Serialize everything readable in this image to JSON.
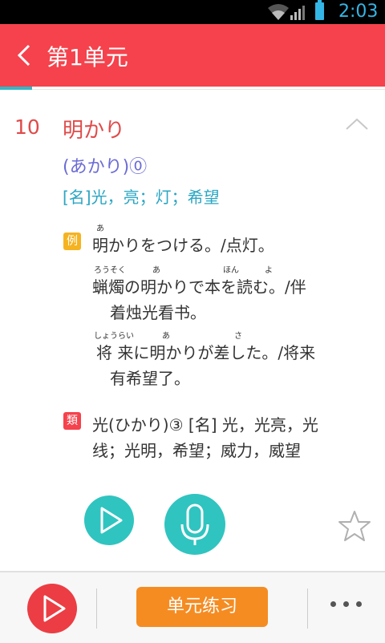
{
  "status_bar": {
    "time": "2:03"
  },
  "header": {
    "title": "第1单元"
  },
  "entry": {
    "number": "10",
    "word": "明かり",
    "reading": "(あかり)⓪",
    "meaning": "[名]光，亮；灯；希望"
  },
  "examples": {
    "badge": "例",
    "lines": [
      {
        "ruby": "あ",
        "text": "明かりをつける。/点灯。"
      },
      {
        "ruby_1": "ろうそく",
        "ruby_2": "あ",
        "ruby_3": "ほん",
        "ruby_4": "よ",
        "text": "蝋燭の明かりで本を読む。/伴"
      },
      {
        "text": "着烛光看书。"
      },
      {
        "ruby_1": "しょうらい",
        "ruby_2": "あ",
        "ruby_3": "さ",
        "text": "将 来に明かりが差した。/将来"
      },
      {
        "text": "有希望了。"
      }
    ]
  },
  "similar": {
    "badge": "類",
    "line1": "光(ひかり)③ [名] 光，光亮，光",
    "line2": "线；光明，希望；威力，威望"
  },
  "bottom_bar": {
    "practice_label": "单元练习"
  },
  "colors": {
    "header": "#f5424c",
    "accent": "#30c4c0",
    "practice": "#f58c22"
  },
  "icons": [
    "wifi-icon",
    "signal-icon",
    "battery-icon",
    "back-arrow-icon",
    "chevron-up-icon",
    "play-icon",
    "microphone-icon",
    "star-icon",
    "more-icon"
  ]
}
